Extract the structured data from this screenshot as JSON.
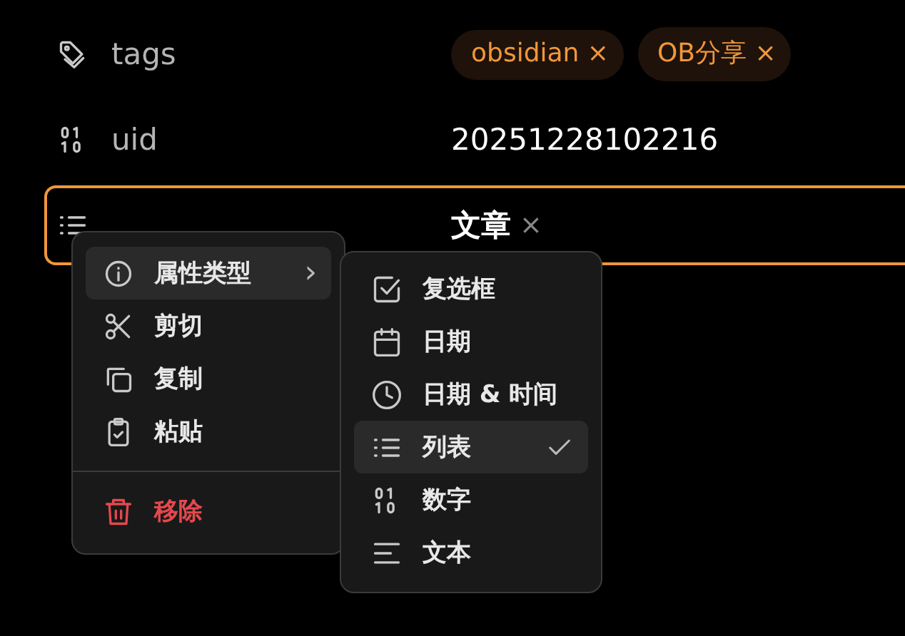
{
  "properties": [
    {
      "kind": "tags",
      "name": "tags",
      "focused": false,
      "values": [
        {
          "label": "obsidian",
          "remove": "×"
        },
        {
          "label": "OB分享",
          "remove": "×"
        }
      ]
    },
    {
      "kind": "number",
      "name": "uid",
      "focused": false,
      "value": "20251228102216"
    },
    {
      "kind": "list",
      "focused": true,
      "values": [
        {
          "label": "文章",
          "remove": "×"
        }
      ]
    }
  ],
  "context_menu": {
    "items": [
      {
        "kind": "info",
        "label": "属性类型",
        "selected": true,
        "arrow": "›"
      },
      {
        "kind": "cut",
        "label": "剪切",
        "selected": false
      },
      {
        "kind": "copy",
        "label": "复制",
        "selected": false
      },
      {
        "kind": "paste",
        "label": "粘贴",
        "selected": false
      },
      {
        "kind": "separator"
      },
      {
        "kind": "remove",
        "label": "移除",
        "selected": false
      }
    ]
  },
  "submenu": {
    "items": [
      {
        "kind": "checkbox",
        "label": "复选框",
        "selected": false
      },
      {
        "kind": "date",
        "label": "日期",
        "selected": false
      },
      {
        "kind": "datetime",
        "label": "日期 & 时间",
        "selected": false
      },
      {
        "kind": "list",
        "label": "列表",
        "selected": true
      },
      {
        "kind": "number",
        "label": "数字",
        "selected": false
      },
      {
        "kind": "text",
        "label": "文本",
        "selected": false
      }
    ]
  }
}
